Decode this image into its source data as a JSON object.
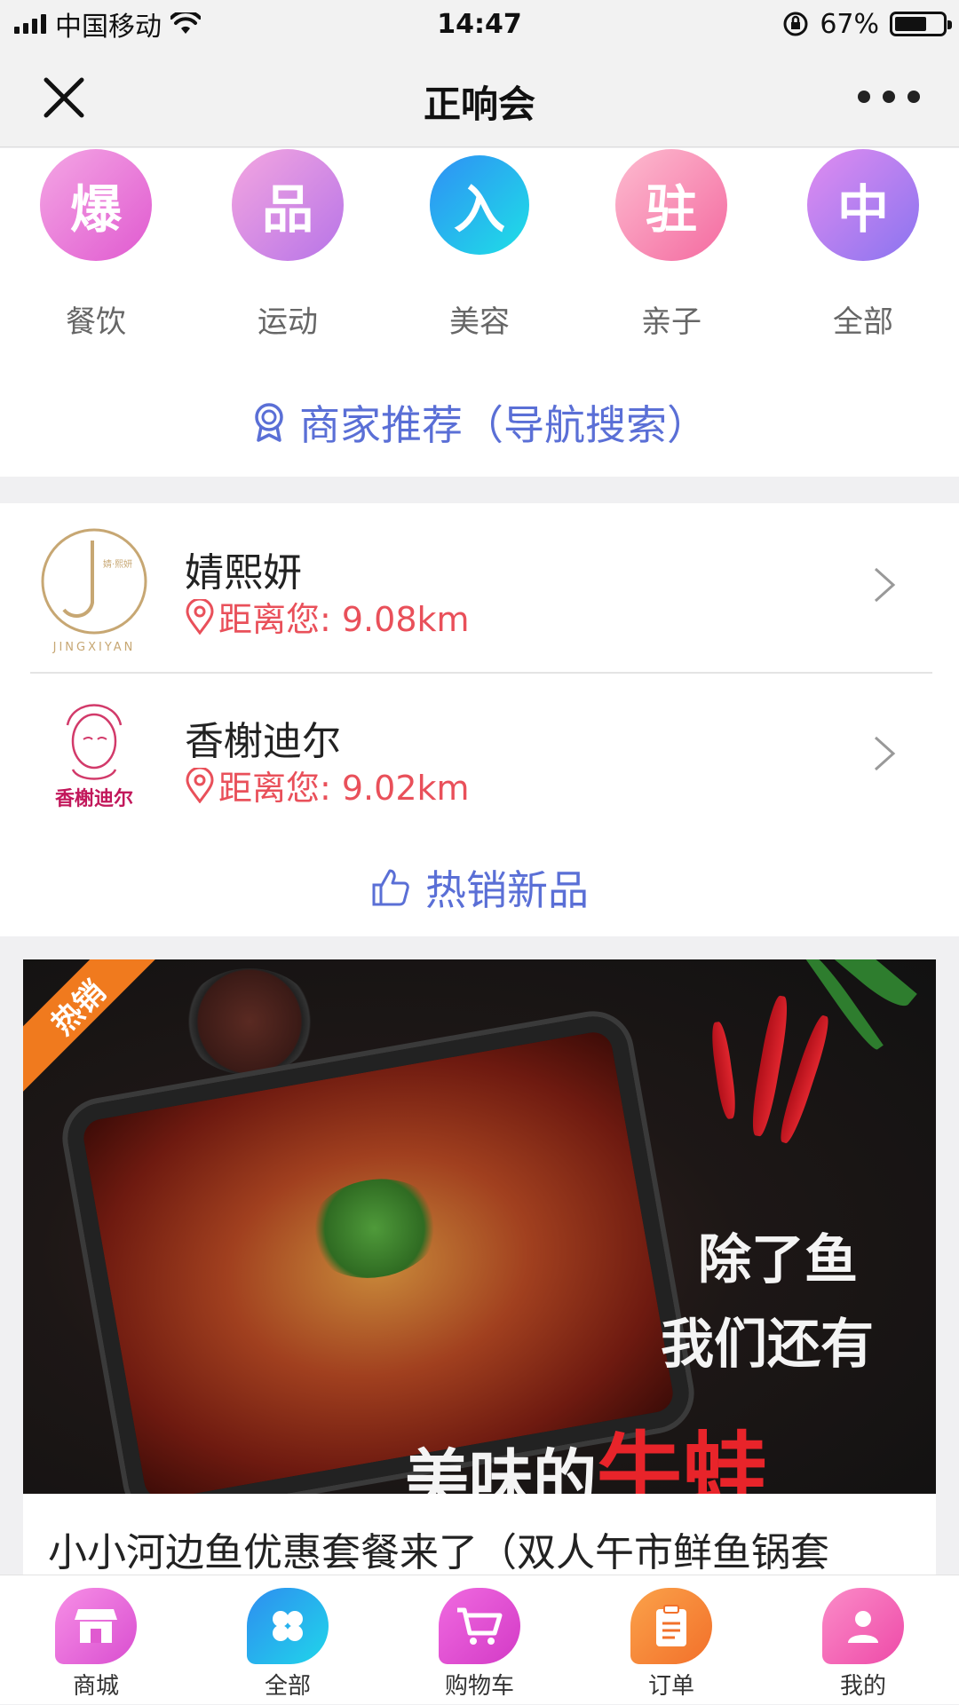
{
  "status_bar": {
    "carrier": "中国移动",
    "time": "14:47",
    "battery": "67%"
  },
  "nav": {
    "title": "正响会"
  },
  "categories": [
    {
      "badge": "爆",
      "label": "餐饮",
      "color_from": "#f49ae0",
      "color_to": "#e05ad0"
    },
    {
      "badge": "品",
      "label": "运动",
      "color_from": "#f0a0e8",
      "color_to": "#b774e8"
    },
    {
      "badge": "入",
      "label": "美容",
      "color_from": "#2fa3f5",
      "color_to": "#1ed6e6"
    },
    {
      "badge": "驻",
      "label": "亲子",
      "color_from": "#fdb6c8",
      "color_to": "#f46aa0"
    },
    {
      "badge": "中",
      "label": "全部",
      "color_from": "#d88af0",
      "color_to": "#8a74f0"
    }
  ],
  "merchant_section": {
    "title": "商家推荐（导航搜索）"
  },
  "merchants": [
    {
      "name": "婧熙妍",
      "distance": "距离您: 9.08km",
      "logo_text": "JINGXIYAN",
      "logo_sub": "婧·熙妍"
    },
    {
      "name": "香榭迪尔",
      "distance": "距离您: 9.02km",
      "logo_text": "香榭迪尔"
    }
  ],
  "hot_section": {
    "title": "热销新品"
  },
  "product": {
    "ribbon": "热销",
    "promo_line1": "除了鱼",
    "promo_line2": "我们还有",
    "promo_line3_a": "美味的",
    "promo_line3_b": "牛蛙",
    "title": "小小河边鱼优惠套餐来了（双人午市鲜鱼锅套"
  },
  "tabbar": [
    {
      "label": "商城",
      "icon": "store-icon",
      "color": "#e860d8"
    },
    {
      "label": "全部",
      "icon": "clover-icon",
      "color": "#22b8f0"
    },
    {
      "label": "购物车",
      "icon": "cart-icon",
      "color": "#e54bd6"
    },
    {
      "label": "订单",
      "icon": "clipboard-icon",
      "color": "#f68a3a"
    },
    {
      "label": "我的",
      "icon": "user-icon",
      "color": "#f05ab4"
    }
  ],
  "colors": {
    "accent": "#5a6fd6",
    "distance": "#e9505a",
    "ribbon": "#f07a1e"
  }
}
